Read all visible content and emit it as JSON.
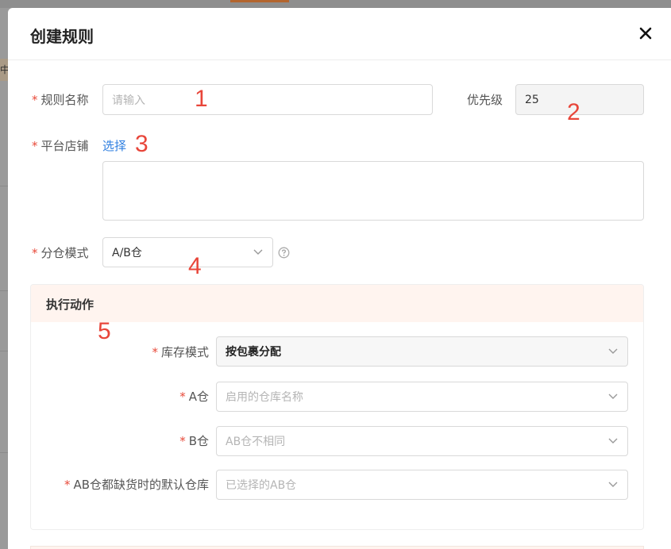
{
  "backdrop": {
    "side_text": "中"
  },
  "modal": {
    "title": "创建规则",
    "close_icon": "close-icon"
  },
  "form": {
    "rule_name": {
      "required": "*",
      "label": "规则名称",
      "placeholder": "请输入",
      "value": ""
    },
    "priority": {
      "label": "优先级",
      "value": "25"
    },
    "shop": {
      "required": "*",
      "label": "平台店铺",
      "select_link": "选择"
    },
    "split_mode": {
      "required": "*",
      "label": "分仓模式",
      "value": "A/B仓"
    }
  },
  "action": {
    "title": "执行动作",
    "stock_mode": {
      "required": "*",
      "label": "库存模式",
      "value": "按包裹分配"
    },
    "warehouse_a": {
      "required": "*",
      "label": "A仓",
      "placeholder": "启用的仓库名称"
    },
    "warehouse_b": {
      "required": "*",
      "label": "B仓",
      "placeholder": "AB仓不相同"
    },
    "default_warehouse": {
      "required": "*",
      "label": "AB仓都缺货时的默认仓库",
      "placeholder": "已选择的AB仓"
    }
  },
  "annotations": [
    "1",
    "2",
    "3",
    "4",
    "5"
  ],
  "colors": {
    "required": "#e84a3a",
    "link": "#2f7fe0",
    "annotation": "#e8463a",
    "action_header": "#fff4ef"
  }
}
